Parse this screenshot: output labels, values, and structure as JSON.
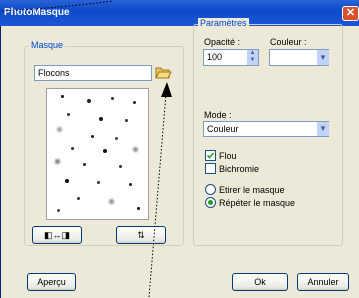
{
  "window": {
    "title": "PhotoMasque",
    "close_symbol": "✕"
  },
  "masque": {
    "legend": "Masque",
    "name_value": "Flocons",
    "flip_h_glyph": "◧↔◨",
    "flip_v_glyph": "⇅"
  },
  "parametres": {
    "legend": "Paramètres",
    "opacite_label": "Opacité :",
    "opacite_value": "100",
    "couleur_label": "Couleur :",
    "mode_label": "Mode :",
    "mode_value": "Couleur",
    "flou_label": "Flou",
    "flou_checked": true,
    "bichromie_label": "Bichromie",
    "bichromie_checked": false,
    "etirer_label": "Etirer le masque",
    "repeter_label": "Répéter le masque",
    "selected_option": "Répéter le masque"
  },
  "buttons": {
    "apercu": "Aperçu",
    "ok": "Ok",
    "annuler": "Annuler"
  },
  "colors": {
    "title_bar": "#0B4AC9",
    "dialog_bg": "#ECE9D8",
    "accent": "#0046D5"
  }
}
